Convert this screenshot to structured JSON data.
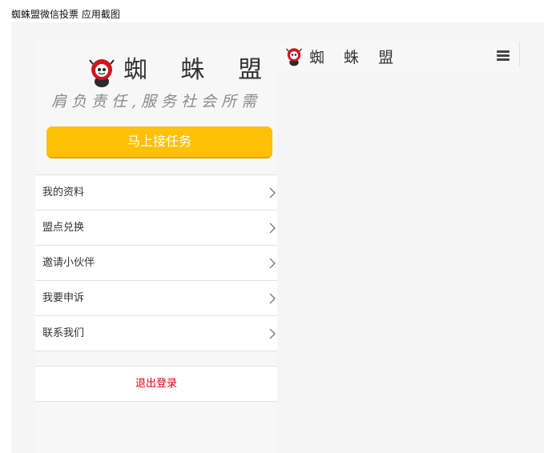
{
  "caption": "蜘蛛盟微信投票 应用截图",
  "drawer": {
    "brand_name": "蜘 蛛 盟",
    "slogan": "肩负责任,服务社会所需",
    "task_button": "马上接任务",
    "menu": [
      {
        "label": "我的资料"
      },
      {
        "label": "盟点兑换"
      },
      {
        "label": "邀请小伙伴"
      },
      {
        "label": "我要申诉"
      },
      {
        "label": "联系我们"
      }
    ],
    "logout": "退出登录"
  },
  "header": {
    "title": "蜘 蛛 盟"
  },
  "colors": {
    "accent": "#fec105",
    "logout": "#e60012",
    "logo_red": "#d2141d"
  },
  "icons": [
    "spider-logo-icon",
    "chevron-right-icon",
    "hamburger-menu-icon"
  ]
}
